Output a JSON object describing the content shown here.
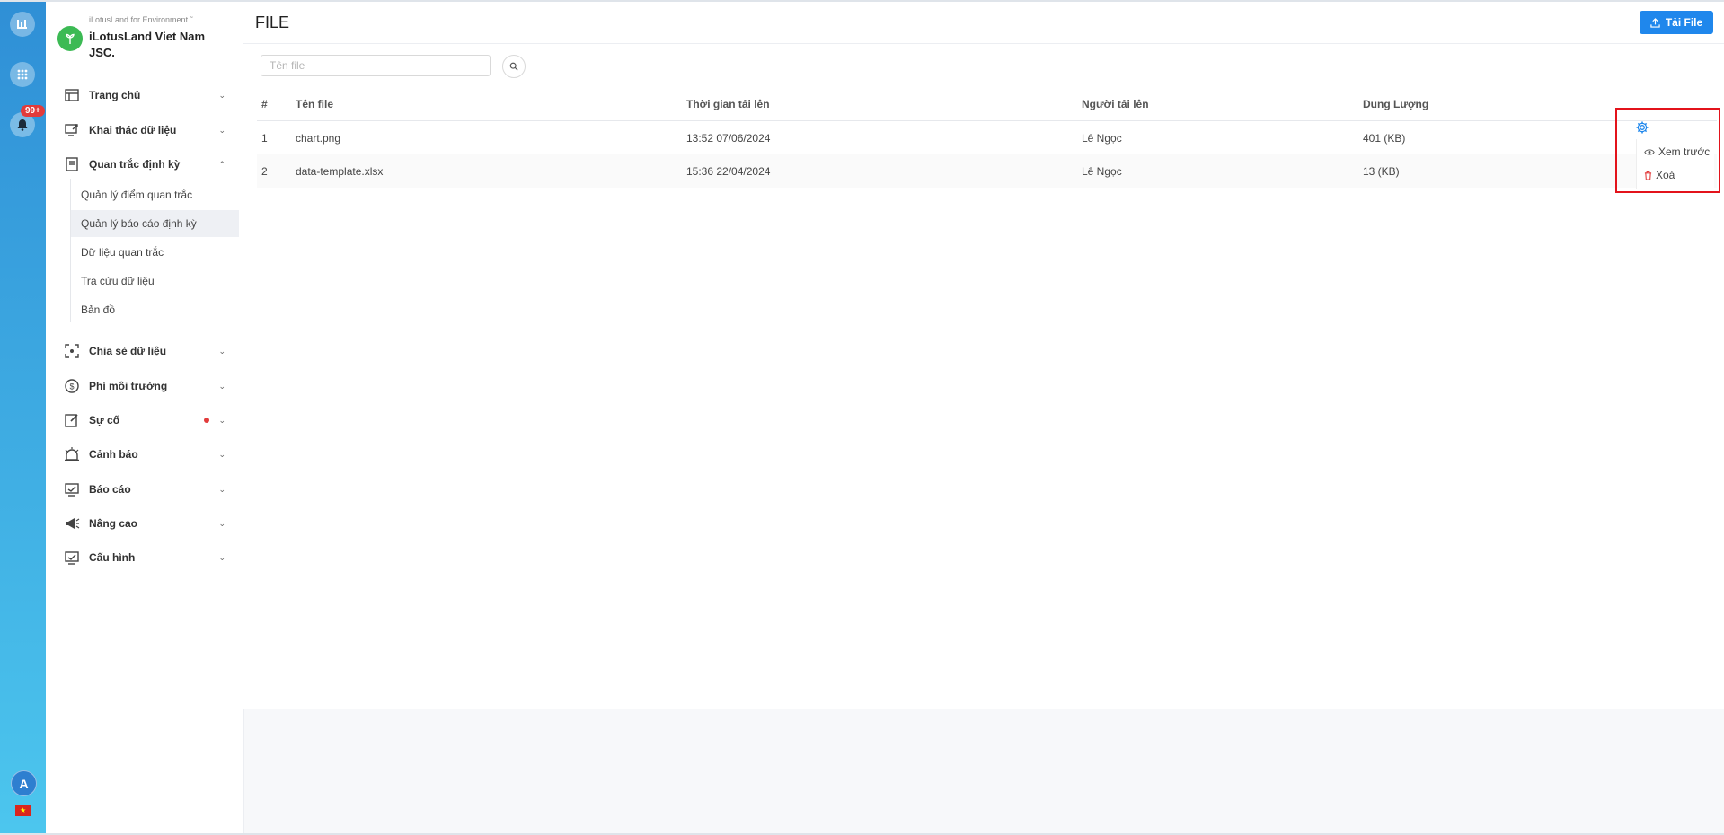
{
  "brand": {
    "small": "iLotusLand for Environment ˜",
    "name": "iLotusLand Viet Nam JSC."
  },
  "rail": {
    "badge": "99+",
    "avatar": "A"
  },
  "nav": {
    "items": [
      {
        "label": "Trang chủ",
        "icon": "home-icon"
      },
      {
        "label": "Khai thác dữ liệu",
        "icon": "data-mining-icon"
      },
      {
        "label": "Quan trắc định kỳ",
        "icon": "periodic-monitor-icon"
      },
      {
        "label": "Chia sẻ dữ liệu",
        "icon": "share-icon"
      },
      {
        "label": "Phí môi trường",
        "icon": "dollar-icon"
      },
      {
        "label": "Sự cố",
        "icon": "edit-icon"
      },
      {
        "label": "Cảnh báo",
        "icon": "alarm-icon"
      },
      {
        "label": "Báo cáo",
        "icon": "report-icon"
      },
      {
        "label": "Nâng cao",
        "icon": "megaphone-icon"
      },
      {
        "label": "Cấu hình",
        "icon": "config-icon"
      }
    ],
    "sub_items": [
      {
        "label": "Quản lý điểm quan trắc"
      },
      {
        "label": "Quản lý báo cáo định kỳ"
      },
      {
        "label": "Dữ liệu quan trắc"
      },
      {
        "label": "Tra cứu dữ liệu"
      },
      {
        "label": "Bản đồ"
      }
    ]
  },
  "header": {
    "title": "FILE",
    "upload_label": "Tải File"
  },
  "search": {
    "placeholder": "Tên file",
    "value": ""
  },
  "table": {
    "columns": [
      "#",
      "Tên file",
      "Thời gian tải lên",
      "Người tải lên",
      "Dung Lượng"
    ],
    "rows": [
      {
        "index": "1",
        "name": "chart.png",
        "time": "13:52 07/06/2024",
        "uploader": "Lê Ngọc",
        "size": "401 (KB)"
      },
      {
        "index": "2",
        "name": "data-template.xlsx",
        "time": "15:36 22/04/2024",
        "uploader": "Lê Ngọc",
        "size": "13 (KB)"
      }
    ]
  },
  "action_menu": {
    "preview_label": "Xem trước",
    "delete_label": "Xoá"
  },
  "colors": {
    "accent": "#1f87ec",
    "danger": "#e23b3b",
    "highlight": "#e3131b",
    "brand_green": "#3cba54"
  }
}
